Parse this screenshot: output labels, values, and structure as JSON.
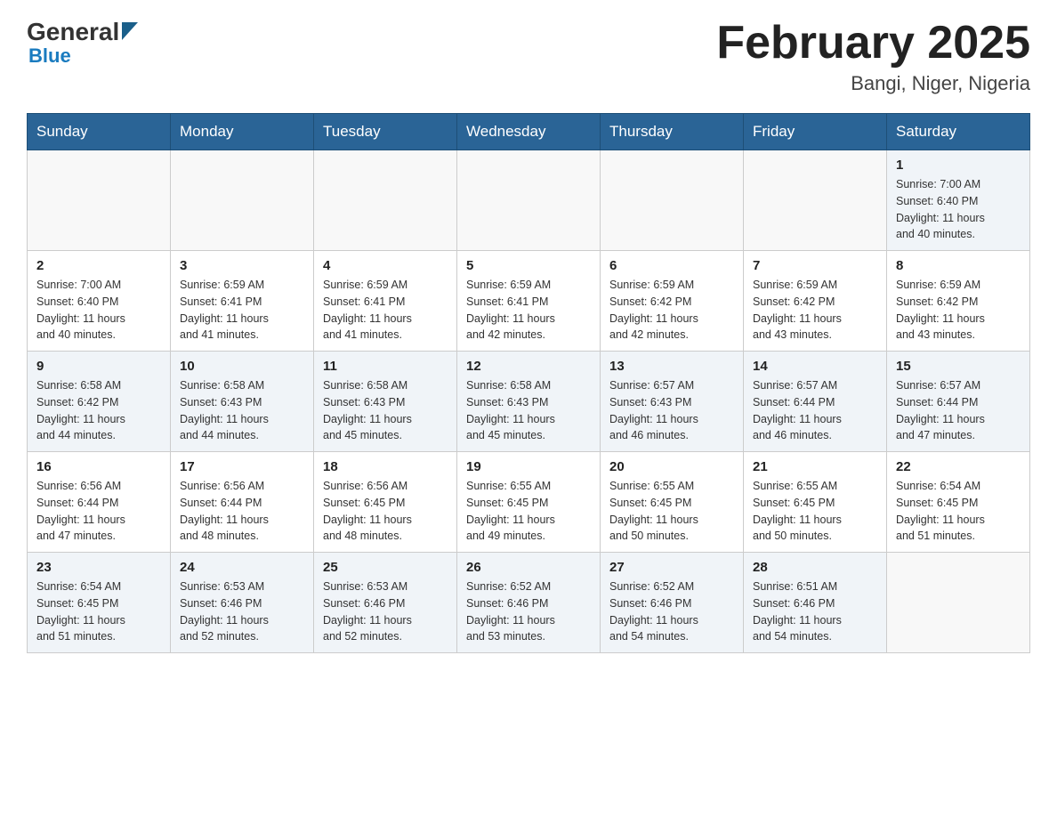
{
  "header": {
    "logo": {
      "general": "General",
      "blue": "Blue"
    },
    "title": "February 2025",
    "location": "Bangi, Niger, Nigeria"
  },
  "days_of_week": [
    "Sunday",
    "Monday",
    "Tuesday",
    "Wednesday",
    "Thursday",
    "Friday",
    "Saturday"
  ],
  "weeks": [
    {
      "cells": [
        {
          "day": null,
          "info": null
        },
        {
          "day": null,
          "info": null
        },
        {
          "day": null,
          "info": null
        },
        {
          "day": null,
          "info": null
        },
        {
          "day": null,
          "info": null
        },
        {
          "day": null,
          "info": null
        },
        {
          "day": "1",
          "info": "Sunrise: 7:00 AM\nSunset: 6:40 PM\nDaylight: 11 hours\nand 40 minutes."
        }
      ]
    },
    {
      "cells": [
        {
          "day": "2",
          "info": "Sunrise: 7:00 AM\nSunset: 6:40 PM\nDaylight: 11 hours\nand 40 minutes."
        },
        {
          "day": "3",
          "info": "Sunrise: 6:59 AM\nSunset: 6:41 PM\nDaylight: 11 hours\nand 41 minutes."
        },
        {
          "day": "4",
          "info": "Sunrise: 6:59 AM\nSunset: 6:41 PM\nDaylight: 11 hours\nand 41 minutes."
        },
        {
          "day": "5",
          "info": "Sunrise: 6:59 AM\nSunset: 6:41 PM\nDaylight: 11 hours\nand 42 minutes."
        },
        {
          "day": "6",
          "info": "Sunrise: 6:59 AM\nSunset: 6:42 PM\nDaylight: 11 hours\nand 42 minutes."
        },
        {
          "day": "7",
          "info": "Sunrise: 6:59 AM\nSunset: 6:42 PM\nDaylight: 11 hours\nand 43 minutes."
        },
        {
          "day": "8",
          "info": "Sunrise: 6:59 AM\nSunset: 6:42 PM\nDaylight: 11 hours\nand 43 minutes."
        }
      ]
    },
    {
      "cells": [
        {
          "day": "9",
          "info": "Sunrise: 6:58 AM\nSunset: 6:42 PM\nDaylight: 11 hours\nand 44 minutes."
        },
        {
          "day": "10",
          "info": "Sunrise: 6:58 AM\nSunset: 6:43 PM\nDaylight: 11 hours\nand 44 minutes."
        },
        {
          "day": "11",
          "info": "Sunrise: 6:58 AM\nSunset: 6:43 PM\nDaylight: 11 hours\nand 45 minutes."
        },
        {
          "day": "12",
          "info": "Sunrise: 6:58 AM\nSunset: 6:43 PM\nDaylight: 11 hours\nand 45 minutes."
        },
        {
          "day": "13",
          "info": "Sunrise: 6:57 AM\nSunset: 6:43 PM\nDaylight: 11 hours\nand 46 minutes."
        },
        {
          "day": "14",
          "info": "Sunrise: 6:57 AM\nSunset: 6:44 PM\nDaylight: 11 hours\nand 46 minutes."
        },
        {
          "day": "15",
          "info": "Sunrise: 6:57 AM\nSunset: 6:44 PM\nDaylight: 11 hours\nand 47 minutes."
        }
      ]
    },
    {
      "cells": [
        {
          "day": "16",
          "info": "Sunrise: 6:56 AM\nSunset: 6:44 PM\nDaylight: 11 hours\nand 47 minutes."
        },
        {
          "day": "17",
          "info": "Sunrise: 6:56 AM\nSunset: 6:44 PM\nDaylight: 11 hours\nand 48 minutes."
        },
        {
          "day": "18",
          "info": "Sunrise: 6:56 AM\nSunset: 6:45 PM\nDaylight: 11 hours\nand 48 minutes."
        },
        {
          "day": "19",
          "info": "Sunrise: 6:55 AM\nSunset: 6:45 PM\nDaylight: 11 hours\nand 49 minutes."
        },
        {
          "day": "20",
          "info": "Sunrise: 6:55 AM\nSunset: 6:45 PM\nDaylight: 11 hours\nand 50 minutes."
        },
        {
          "day": "21",
          "info": "Sunrise: 6:55 AM\nSunset: 6:45 PM\nDaylight: 11 hours\nand 50 minutes."
        },
        {
          "day": "22",
          "info": "Sunrise: 6:54 AM\nSunset: 6:45 PM\nDaylight: 11 hours\nand 51 minutes."
        }
      ]
    },
    {
      "cells": [
        {
          "day": "23",
          "info": "Sunrise: 6:54 AM\nSunset: 6:45 PM\nDaylight: 11 hours\nand 51 minutes."
        },
        {
          "day": "24",
          "info": "Sunrise: 6:53 AM\nSunset: 6:46 PM\nDaylight: 11 hours\nand 52 minutes."
        },
        {
          "day": "25",
          "info": "Sunrise: 6:53 AM\nSunset: 6:46 PM\nDaylight: 11 hours\nand 52 minutes."
        },
        {
          "day": "26",
          "info": "Sunrise: 6:52 AM\nSunset: 6:46 PM\nDaylight: 11 hours\nand 53 minutes."
        },
        {
          "day": "27",
          "info": "Sunrise: 6:52 AM\nSunset: 6:46 PM\nDaylight: 11 hours\nand 54 minutes."
        },
        {
          "day": "28",
          "info": "Sunrise: 6:51 AM\nSunset: 6:46 PM\nDaylight: 11 hours\nand 54 minutes."
        },
        {
          "day": null,
          "info": null
        }
      ]
    }
  ]
}
